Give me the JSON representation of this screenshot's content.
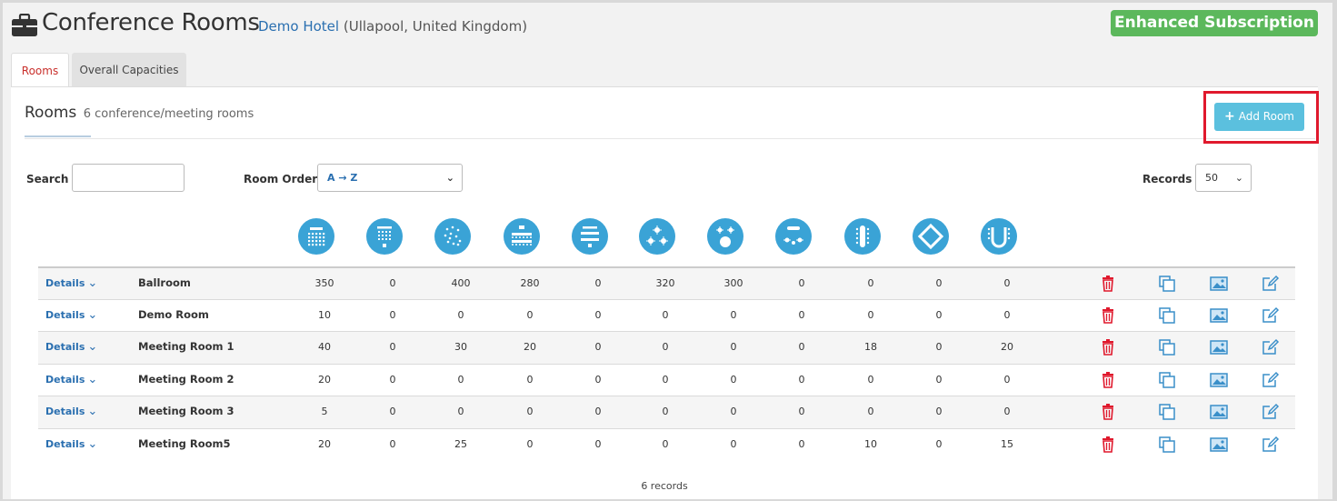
{
  "header": {
    "title": "Conference Rooms",
    "hotel_name": "Demo Hotel",
    "hotel_location": "(Ullapool, United Kingdom)",
    "subscription": "Enhanced Subscription"
  },
  "tabs": [
    {
      "label": "Rooms",
      "active": true
    },
    {
      "label": "Overall Capacities",
      "active": false
    }
  ],
  "section": {
    "title": "Rooms",
    "subtitle": "6 conference/meeting rooms",
    "add_button": "Add Room"
  },
  "filters": {
    "search_label": "Search",
    "search_value": "",
    "order_label": "Room Order",
    "order_value": "A → Z",
    "records_label": "Records",
    "records_value": "50"
  },
  "layouts": [
    "theatre-layout-icon",
    "classroom-layout-icon",
    "reception-layout-icon",
    "boardroom-dinner-layout-icon",
    "presentation-layout-icon",
    "cabaret-layout-icon",
    "banquet-stage-layout-icon",
    "cabaret-stage-layout-icon",
    "boardroom-layout-icon",
    "hollow-square-layout-icon",
    "u-shape-layout-icon"
  ],
  "details_label": "Details",
  "rooms": [
    {
      "name": "Ballroom",
      "caps": [
        "350",
        "0",
        "400",
        "280",
        "0",
        "320",
        "300",
        "0",
        "0",
        "0",
        "0"
      ]
    },
    {
      "name": "Demo Room",
      "caps": [
        "10",
        "0",
        "0",
        "0",
        "0",
        "0",
        "0",
        "0",
        "0",
        "0",
        "0"
      ]
    },
    {
      "name": "Meeting Room 1",
      "caps": [
        "40",
        "0",
        "30",
        "20",
        "0",
        "0",
        "0",
        "0",
        "18",
        "0",
        "20"
      ]
    },
    {
      "name": "Meeting Room 2",
      "caps": [
        "20",
        "0",
        "0",
        "0",
        "0",
        "0",
        "0",
        "0",
        "0",
        "0",
        "0"
      ]
    },
    {
      "name": "Meeting Room 3",
      "caps": [
        "5",
        "0",
        "0",
        "0",
        "0",
        "0",
        "0",
        "0",
        "0",
        "0",
        "0"
      ]
    },
    {
      "name": "Meeting Room5",
      "caps": [
        "20",
        "0",
        "25",
        "0",
        "0",
        "0",
        "0",
        "0",
        "10",
        "0",
        "15"
      ]
    }
  ],
  "footer": "6 records",
  "colors": {
    "accent": "#3aa3d6",
    "success": "#5cb85c",
    "danger": "#e0192d",
    "link": "#2a6fb0"
  }
}
